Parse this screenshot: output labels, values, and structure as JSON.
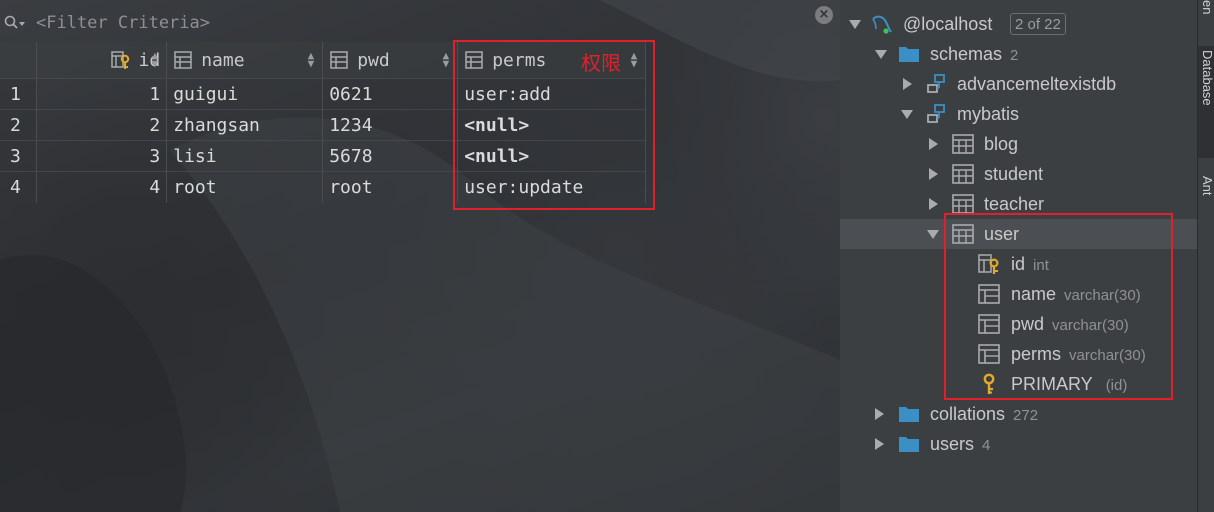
{
  "filter": {
    "placeholder": "<Filter Criteria>"
  },
  "grid": {
    "columns": [
      {
        "label": "id",
        "icon": "primary-key-column-icon"
      },
      {
        "label": "name",
        "icon": "column-icon"
      },
      {
        "label": "pwd",
        "icon": "column-icon"
      },
      {
        "label": "perms",
        "icon": "column-icon"
      }
    ],
    "rows": [
      {
        "n": "1",
        "id": "1",
        "name": "guigui",
        "pwd": "0621",
        "perms": "user:add"
      },
      {
        "n": "2",
        "id": "2",
        "name": "zhangsan",
        "pwd": "1234",
        "perms": "<null>"
      },
      {
        "n": "3",
        "id": "3",
        "name": "lisi",
        "pwd": "5678",
        "perms": "<null>"
      },
      {
        "n": "4",
        "id": "4",
        "name": "root",
        "pwd": "root",
        "perms": "user:update"
      }
    ],
    "annotation": "权限"
  },
  "tree": {
    "host": "@localhost",
    "host_count": "2 of 22",
    "schemas": {
      "label": "schemas",
      "count": "2"
    },
    "db1": "advancemeltexistdb",
    "db2": "mybatis",
    "tables": [
      "blog",
      "student",
      "teacher",
      "user"
    ],
    "columns": [
      {
        "name": "id",
        "type": "int"
      },
      {
        "name": "name",
        "type": "varchar(30)"
      },
      {
        "name": "pwd",
        "type": "varchar(30)"
      },
      {
        "name": "perms",
        "type": "varchar(30)"
      }
    ],
    "key": {
      "name": "PRIMARY",
      "detail": "(id)"
    },
    "collations": {
      "label": "collations",
      "count": "272"
    },
    "users": {
      "label": "users",
      "count": "4"
    }
  },
  "strip": {
    "tab1": "Database",
    "tab2": "Ant",
    "tab_top": "en"
  },
  "colors": {
    "null": "#21c9d8",
    "annotation": "#e0202a",
    "folder": "#3b8fc4"
  }
}
